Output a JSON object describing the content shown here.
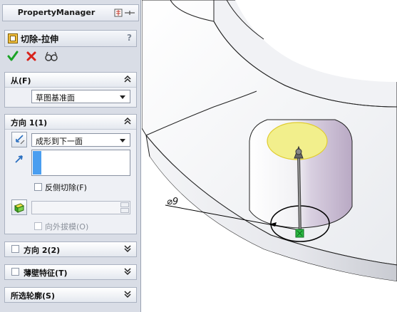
{
  "panel": {
    "title": "PropertyManager",
    "feature_name": "切除-拉伸",
    "help_label": "?"
  },
  "from_group": {
    "title": "从(F)",
    "selected": "草图基准面"
  },
  "direction1": {
    "title": "方向 1(1)",
    "end_condition": "成形到下一面",
    "reverse_cut_label": "反侧切除(F)",
    "depth_value": "",
    "draft_outward_label": "向外拔模(O)"
  },
  "direction2": {
    "title": "方向 2(2)"
  },
  "thin_feature": {
    "title": "薄壁特征(T)"
  },
  "selected_contours": {
    "title": "所选轮廓(S)"
  },
  "viewport": {
    "dimension_label": "⌀9"
  },
  "colors": {
    "accept": "#1aa326",
    "cancel": "#d8221b",
    "highlight": "#f2ef8c",
    "selection_blue": "#4a9ef0"
  }
}
